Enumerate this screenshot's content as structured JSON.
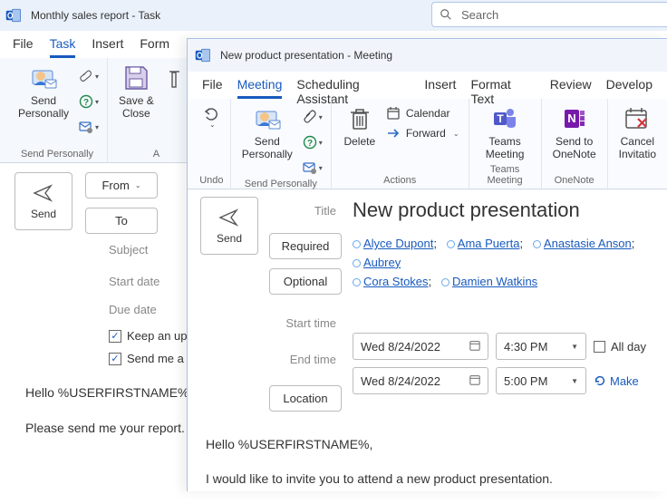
{
  "back": {
    "title": "Monthly sales report  -  Task",
    "search_placeholder": "Search",
    "menu": {
      "file": "File",
      "task": "Task",
      "insert": "Insert",
      "format": "Form"
    },
    "ribbon": {
      "send_personally": "Send\nPersonally",
      "save_close": "Save &\nClose",
      "group1": "Send Personally",
      "group2_partial": "A"
    },
    "compose": {
      "send": "Send",
      "from": "From",
      "to": "To",
      "subject": "Subject",
      "start_date": "Start date",
      "due_date": "Due date",
      "keep_updated": "Keep an upda",
      "send_status": "Send me a st"
    },
    "body": {
      "line1": "Hello %USERFIRSTNAME%,",
      "line2": "Please send me your report."
    }
  },
  "front": {
    "title": "New product presentation  -  Meeting",
    "menu": {
      "file": "File",
      "meeting": "Meeting",
      "sched": "Scheduling Assistant",
      "insert": "Insert",
      "format": "Format Text",
      "review": "Review",
      "dev": "Develop"
    },
    "ribbon": {
      "undo": "Undo",
      "send_personally": "Send\nPersonally",
      "group_sp": "Send Personally",
      "delete": "Delete",
      "calendar": "Calendar",
      "forward": "Forward",
      "group_actions": "Actions",
      "teams": "Teams\nMeeting",
      "group_teams": "Teams Meeting",
      "onenote": "Send to\nOneNote",
      "group_onenote": "OneNote",
      "cancel": "Cancel\nInvitatio"
    },
    "compose": {
      "send": "Send",
      "title_label": "Title",
      "title_value": "New product presentation",
      "required": "Required",
      "optional": "Optional",
      "attendees": [
        "Alyce Dupont",
        "Ama Puerta",
        "Anastasie Anson",
        "Aubrey",
        "Cora Stokes",
        "Damien Watkins"
      ],
      "start_label": "Start time",
      "end_label": "End time",
      "start_date": "Wed 8/24/2022",
      "start_time": "4:30 PM",
      "end_date": "Wed 8/24/2022",
      "end_time": "5:00 PM",
      "all_day": "All day",
      "make": "Make",
      "location": "Location"
    },
    "body": {
      "line1": "Hello %USERFIRSTNAME%,",
      "line2": "I would like to invite you to attend a new product presentation."
    }
  }
}
